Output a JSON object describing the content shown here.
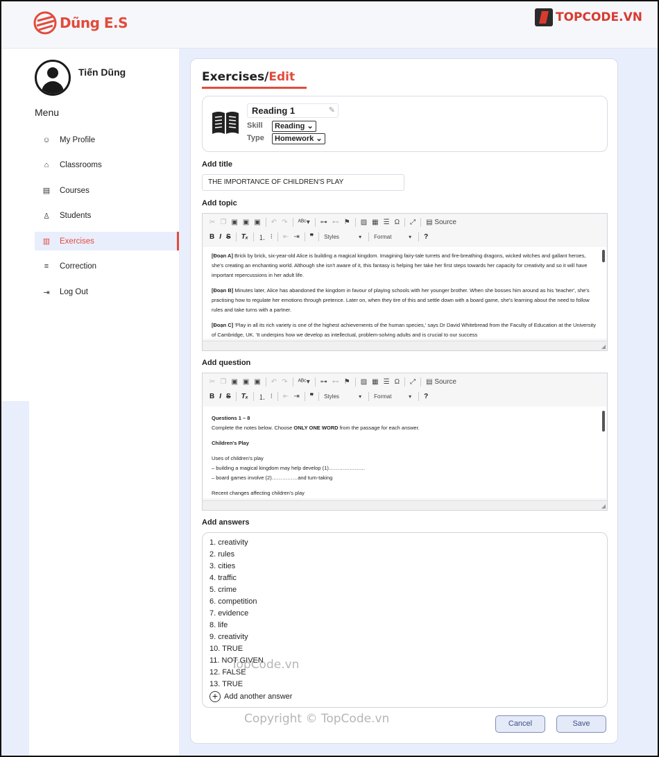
{
  "brand": {
    "name": "Dũng E.S",
    "color": "#e24a3b"
  },
  "source_logo": {
    "text": "TOPCODE.VN"
  },
  "user": {
    "name": "Tiến Dũng"
  },
  "menu": {
    "title": "Menu",
    "items": [
      {
        "label": "My Profile",
        "icon": "profile-icon"
      },
      {
        "label": "Classrooms",
        "icon": "graduation-cap-icon"
      },
      {
        "label": "Courses",
        "icon": "courses-icon"
      },
      {
        "label": "Students",
        "icon": "student-icon"
      },
      {
        "label": "Exercises",
        "icon": "book-icon",
        "active": true
      },
      {
        "label": "Correction",
        "icon": "correction-icon"
      },
      {
        "label": "Log Out",
        "icon": "logout-icon"
      }
    ]
  },
  "page": {
    "title": "Exercises/",
    "subtitle": "Edit"
  },
  "exercise": {
    "name": "Reading 1",
    "skill_label": "Skill",
    "skill_value": "Reading",
    "type_label": "Type",
    "type_value": "Homework"
  },
  "labels": {
    "add_title": "Add title",
    "add_topic": "Add topic",
    "add_question": "Add question",
    "add_answers": "Add answers"
  },
  "title_value": "THE IMPORTANCE OF CHILDREN'S PLAY",
  "editor_toolbar": {
    "source": "Source",
    "styles": "Styles",
    "format": "Format"
  },
  "topic": {
    "paragraphs": [
      {
        "tag": "[Đoạn A]",
        "text": " Brick by brick, six-year-old Alice is building a magical kingdom. Imagining fairy-tale turrets and fire-breathing dragons, wicked witches and gallant heroes, she's creating an enchanting world. Although she isn't aware of it, this fantasy is helping her take her first steps towards her capacity for creativity and so it will have important repercussions in her adult life."
      },
      {
        "tag": "[Đoạn B]",
        "text": " Minutes later, Alice has abandoned the kingdom in favour of playing schools with her younger brother. When she bosses him around as his 'teacher', she's practising how to regulate her emotions through pretence. Later on, when they tire of this and settle down with a board game, she's learning about the need to follow rules and take turns with a partner."
      },
      {
        "tag": "[Đoạn C]",
        "text": " 'Play in all its rich variety is one of the highest achievements of the human species,' says Dr David Whitebread from the Faculty of Education at the University of Cambridge, UK. 'It underpins how we develop as intellectual, problem-solving adults and is crucial to our success"
      }
    ]
  },
  "question": {
    "heading": "Questions 1 – 8",
    "instruction_before": "Complete the notes below. Choose ",
    "instruction_strong": "ONLY ONE WORD",
    "instruction_after": " from the passage for each answer.",
    "subheading": "Children's Play",
    "group1_title": "Uses of children's play",
    "group1_line1": "– building a magical kingdom may help develop (1)…………………",
    "group1_line2": "– board games involve (2)……………and turn-taking",
    "group2_title": "Recent changes affecting children's play"
  },
  "answers": [
    "1. creativity",
    "2. rules",
    "3. cities",
    "4. traffic",
    "5. crime",
    "6. competition",
    "7. evidence",
    "8. life",
    "9. creativity",
    "10. TRUE",
    "11. NOT GIVEN",
    "12. FALSE",
    "13. TRUE"
  ],
  "add_answer_label": "Add another answer",
  "buttons": {
    "cancel": "Cancel",
    "save": "Save"
  },
  "watermarks": {
    "center": "TopCode.vn",
    "bottom": "Copyright © TopCode.vn"
  }
}
